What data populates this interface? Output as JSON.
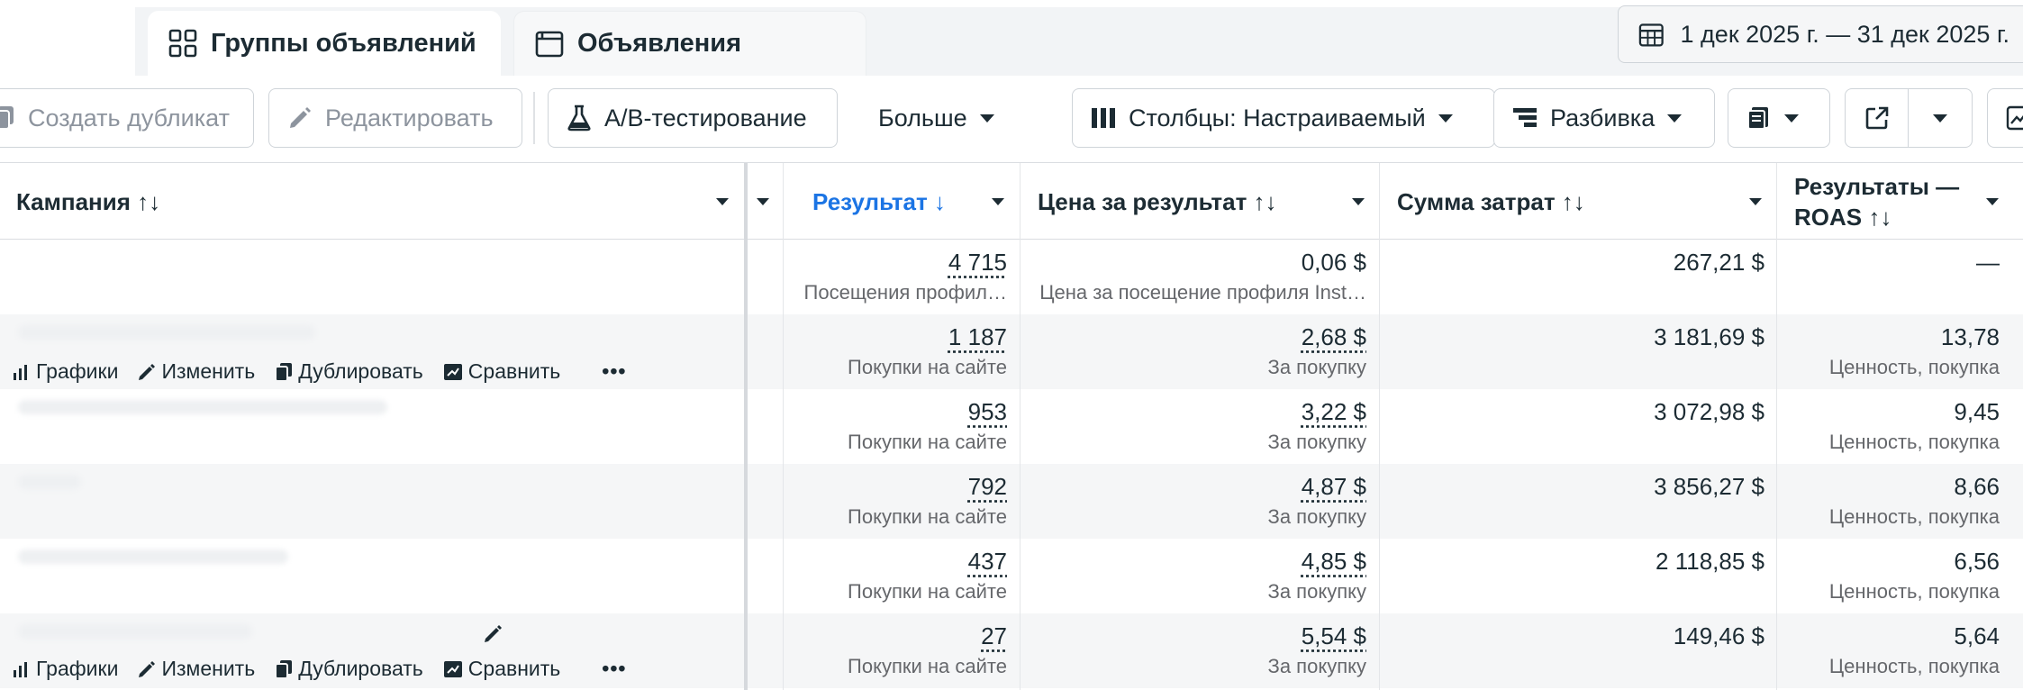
{
  "tabs": [
    {
      "label": "Группы объявлений",
      "active": true
    },
    {
      "label": "Объявления",
      "active": false
    }
  ],
  "date_range": "1 дек 2025 г. — 31 дек 2025 г.",
  "toolbar": {
    "duplicate": "Создать дубликат",
    "edit": "Редактировать",
    "ab_test": "A/B-тестирование",
    "more": "Больше",
    "columns": "Столбцы: Настраиваемый",
    "breakdown": "Разбивка"
  },
  "columns": {
    "campaign": "Кампания ↑↓",
    "result": "Результат ↓",
    "cost_per_result": "Цена за результат ↑↓",
    "amount_spent": "Сумма затрат ↑↓",
    "roas_line1": "Результаты —",
    "roas_line2": "ROAS ↑↓"
  },
  "row_actions": {
    "charts": "Графики",
    "edit": "Изменить",
    "duplicate": "Дублировать",
    "compare": "Сравнить",
    "more": "•••"
  },
  "rows": [
    {
      "result": "4 715",
      "result_sub": "Посещения профил…",
      "cpr": "0,06 $",
      "cpr_sub": "Цена за посещение профиля Inst…",
      "spent": "267,21 $",
      "roas": "—",
      "roas_sub": ""
    },
    {
      "result": "1 187",
      "result_sub": "Покупки на сайте",
      "cpr": "2,68 $",
      "cpr_sub": "За покупку",
      "spent": "3 181,69 $",
      "roas": "13,78",
      "roas_sub": "Ценность, покупка"
    },
    {
      "result": "953",
      "result_sub": "Покупки на сайте",
      "cpr": "3,22 $",
      "cpr_sub": "За покупку",
      "spent": "3 072,98 $",
      "roas": "9,45",
      "roas_sub": "Ценность, покупка"
    },
    {
      "result": "792",
      "result_sub": "Покупки на сайте",
      "cpr": "4,87 $",
      "cpr_sub": "За покупку",
      "spent": "3 856,27 $",
      "roas": "8,66",
      "roas_sub": "Ценность, покупка"
    },
    {
      "result": "437",
      "result_sub": "Покупки на сайте",
      "cpr": "4,85 $",
      "cpr_sub": "За покупку",
      "spent": "2 118,85 $",
      "roas": "6,56",
      "roas_sub": "Ценность, покупка"
    },
    {
      "result": "27",
      "result_sub": "Покупки на сайте",
      "cpr": "5,54 $",
      "cpr_sub": "За покупку",
      "spent": "149,46 $",
      "roas": "5,64",
      "roas_sub": "Ценность, покупка"
    }
  ],
  "colors": {
    "accent": "#1b74e4",
    "text": "#1c2b33",
    "muted": "#65676b",
    "row_alt": "#f5f6f7"
  }
}
